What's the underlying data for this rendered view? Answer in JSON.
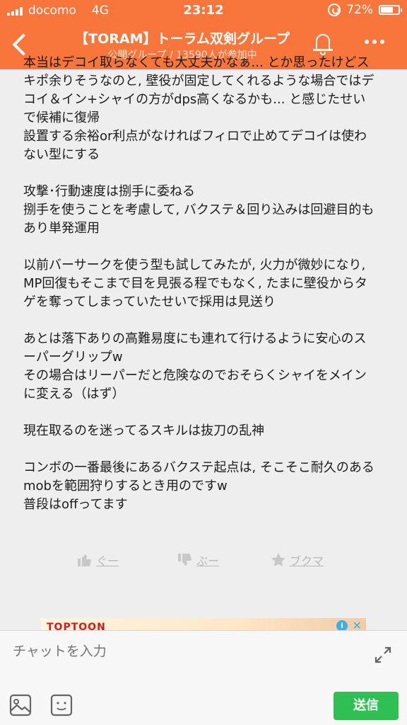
{
  "status_bar": {
    "carrier": "docomo",
    "network": "4G",
    "time": "23:12",
    "battery": "72%",
    "battery_level": 0.72
  },
  "header": {
    "title": "【TORAM】トーラム双剣グループ",
    "subtitle": "公開グループ / 13590人が参加中",
    "accent_color": "#f8753c",
    "icons": [
      "back-chevron-icon",
      "bell-icon",
      "more-dots-icon"
    ]
  },
  "message": {
    "paragraphs": [
      "本当はデコイ取らなくても大丈夫かなぁ... とか思ったけどスキポ余りそうなのと, 壁役が固定してくれるような場合ではデコイ＆イン+シャイの方がdps高くなるかも... と感じたせいで候補に復帰\n設置する余裕or利点がなければフィロで止めてデコイは使わない型にする",
      "攻撃･行動速度は捌手に委ねる\n捌手を使うことを考慮して, バクステ＆回り込みは回避目的もあり単発運用",
      "以前バーサークを使う型も試してみたが, 火力が微妙になり, MP回復もそこまで目を見張る程でもなく, たまに壁役からタゲを奪ってしまっていたせいで採用は見送り",
      "あとは落下ありの高難易度にも連れて行けるように安心のスーパーグリップw\nその場合はリーパーだと危険なのでおそらくシャイをメインに変える（はず）",
      "現在取るのを迷ってるスキルは抜刀の乱神",
      "コンボの一番最後にあるバクステ起点は, そこそこ耐久のあるmobを範囲狩りするとき用のですw\n普段はoffってます"
    ]
  },
  "reactions": {
    "good_label": "ぐー",
    "boo_label": "ぶー",
    "bookmark_label": "ブクマ"
  },
  "ad": {
    "brand": "TOPTOON",
    "info_glyph": "i",
    "close_glyph": "✕"
  },
  "chat": {
    "input_placeholder": "チャットを入力",
    "send_label": "送信",
    "send_color": "#2fbf52"
  }
}
